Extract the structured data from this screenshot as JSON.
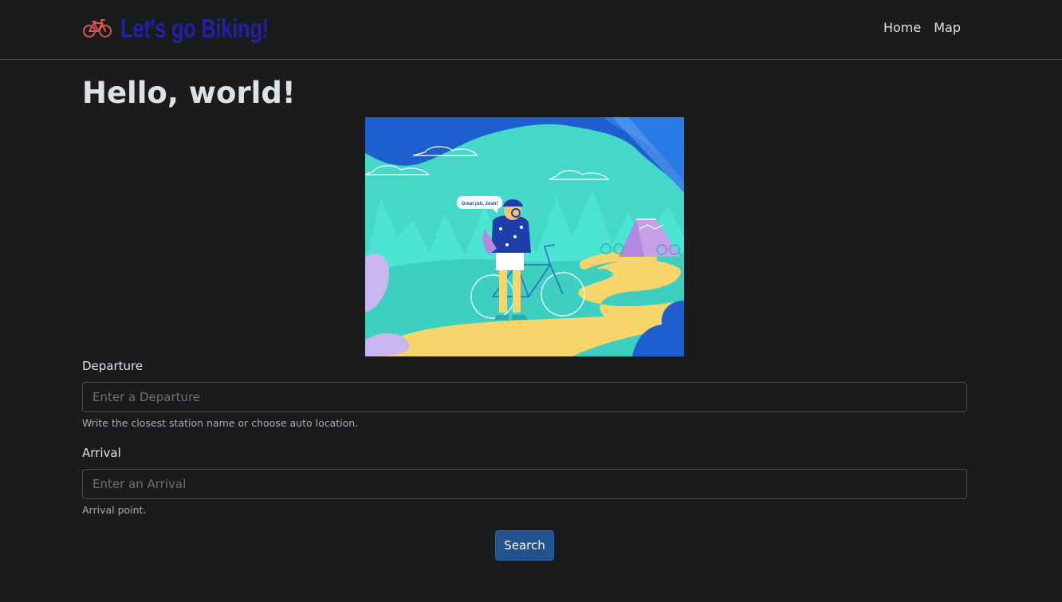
{
  "navbar": {
    "brand_icon": "bicycle-icon",
    "brand_text": "Let's go Biking!",
    "brand_color": "#231ea6",
    "links": [
      {
        "label": "Home"
      },
      {
        "label": "Map"
      }
    ]
  },
  "main": {
    "title": "Hello, world!",
    "hero_image": {
      "speech_bubble": "Great job, Josh!"
    },
    "departure": {
      "label": "Departure",
      "placeholder": "Enter a Departure",
      "value": "",
      "help": "Write the closest station name or choose auto location."
    },
    "arrival": {
      "label": "Arrival",
      "placeholder": "Enter an Arrival",
      "value": "",
      "help": "Arrival point."
    },
    "search_label": "Search"
  },
  "colors": {
    "background": "#1a1b1d",
    "primary_button": "#23538e",
    "icon_red": "#d9534f"
  }
}
